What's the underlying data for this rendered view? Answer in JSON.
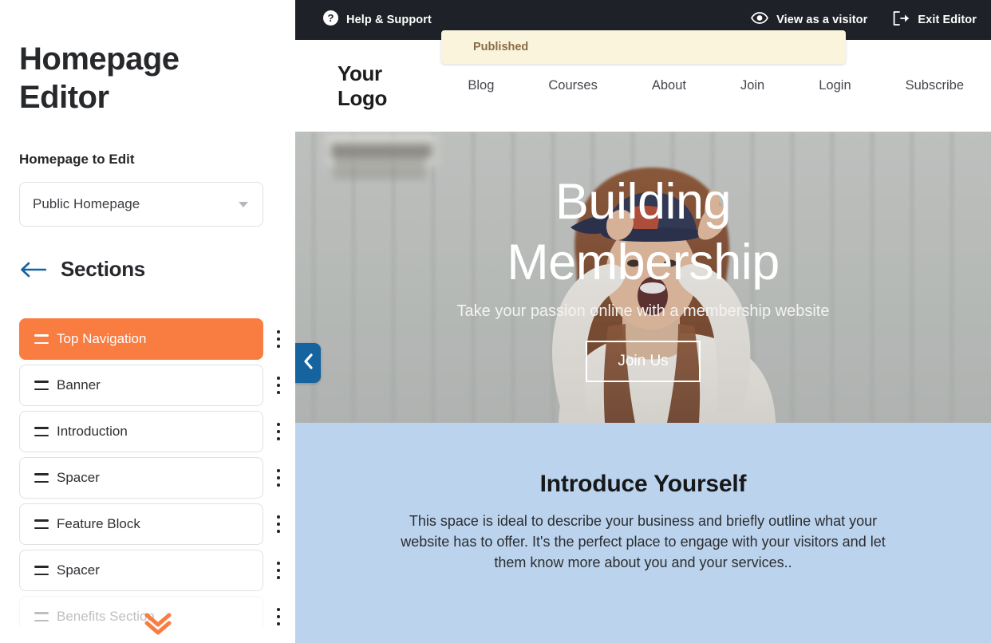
{
  "sidebar": {
    "title": "Homepage Editor",
    "homepage_label": "Homepage to Edit",
    "homepage_select": {
      "value": "Public Homepage",
      "icon": "chevron-down-icon"
    },
    "sections_header": {
      "back_icon": "arrow-left-icon",
      "title": "Sections"
    },
    "sections": [
      {
        "label": "Top Navigation",
        "active": true,
        "faded": false
      },
      {
        "label": "Banner",
        "active": false,
        "faded": false
      },
      {
        "label": "Introduction",
        "active": false,
        "faded": false
      },
      {
        "label": "Spacer",
        "active": false,
        "faded": false
      },
      {
        "label": "Feature Block",
        "active": false,
        "faded": false
      },
      {
        "label": "Spacer",
        "active": false,
        "faded": false
      },
      {
        "label": "Benefits Section",
        "active": false,
        "faded": true
      }
    ],
    "scroll_hint_icon": "double-chevron-down-icon",
    "accent_color": "#F97C41",
    "link_color": "#15639F"
  },
  "topbar": {
    "help_icon": "question-circle-icon",
    "help_label": "Help & Support",
    "view_icon": "eye-icon",
    "view_label": "View as a visitor",
    "exit_icon": "logout-icon",
    "exit_label": "Exit Editor",
    "background_color": "#1E2127"
  },
  "toast": {
    "message": "Published",
    "background_color": "#FBF4DD",
    "text_color": "#8A6C44"
  },
  "preview": {
    "logo": "Your Logo",
    "nav_links": [
      "Blog",
      "Courses",
      "About",
      "Join",
      "Login",
      "Subscribe"
    ],
    "hero": {
      "heading": "Building Membership",
      "subheading": "Take your passion online with a membership website",
      "cta_label": "Join Us"
    },
    "collapse_icon": "chevron-left-icon",
    "intro": {
      "heading": "Introduce Yourself",
      "body": "This space is ideal to describe your business and briefly outline what your website has to offer. It's the perfect place to engage with your visitors and let them know more about you and your services..",
      "background_color": "#BBD3EC"
    }
  }
}
